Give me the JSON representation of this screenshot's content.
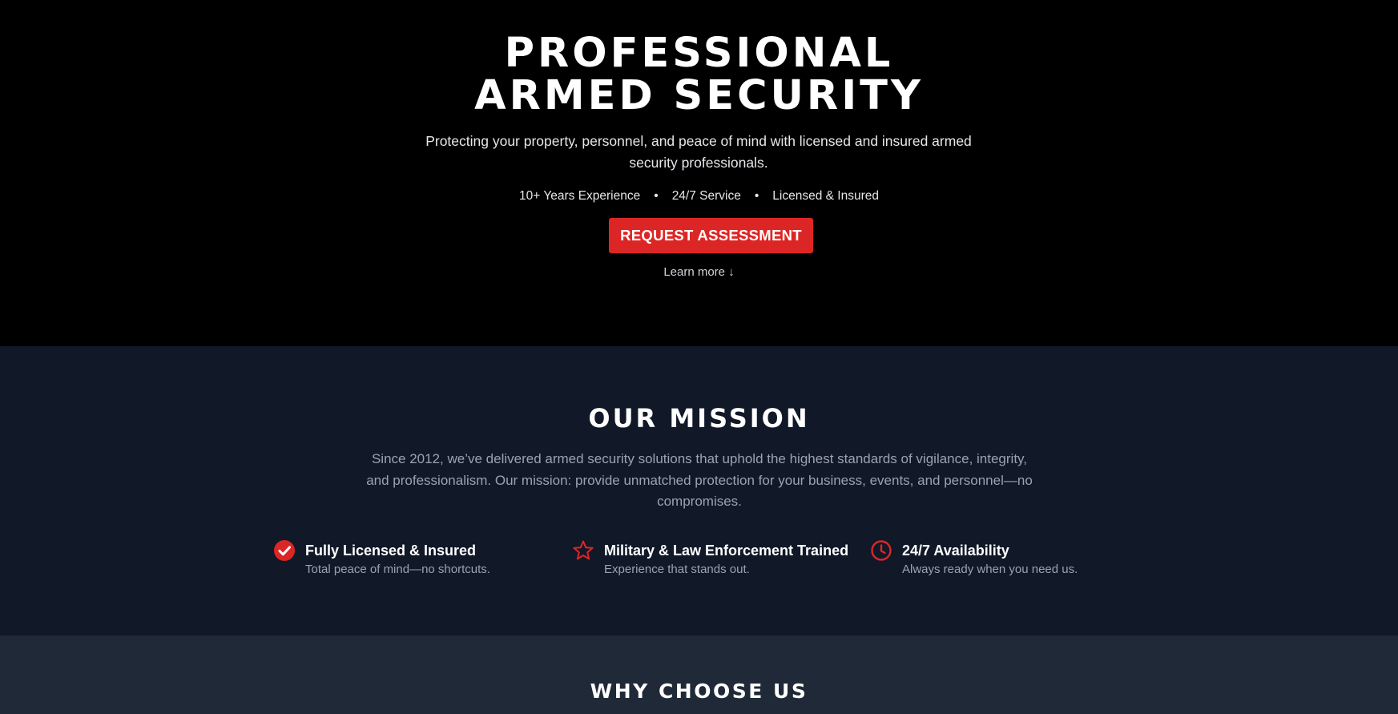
{
  "hero": {
    "title_line1": "PROFESSIONAL",
    "title_line2": "ARMED SECURITY",
    "subtitle": "Protecting your property, personnel, and peace of mind with licensed and insured armed security professionals.",
    "badges": [
      "10+ Years Experience",
      "24/7 Service",
      "Licensed & Insured"
    ],
    "badge_separator": "•",
    "cta_label": "REQUEST ASSESSMENT",
    "learn_more": "Learn more ↓"
  },
  "mission": {
    "title": "OUR MISSION",
    "text": "Since 2012, we’ve delivered armed security solutions that uphold the highest standards of vigilance, integrity, and professionalism. Our mission: provide unmatched protection for your business, events, and personnel—no compromises.",
    "features": [
      {
        "icon": "check-circle-icon",
        "title": "Fully Licensed & Insured",
        "desc": "Total peace of mind—no shortcuts."
      },
      {
        "icon": "star-icon",
        "title": "Military & Law Enforcement Trained",
        "desc": "Experience that stands out."
      },
      {
        "icon": "clock-icon",
        "title": "24/7 Availability",
        "desc": "Always ready when you need us."
      }
    ]
  },
  "why": {
    "title": "WHY CHOOSE US"
  },
  "colors": {
    "accent": "#dc2626",
    "hero_bg": "#000000",
    "mission_bg": "#111827",
    "why_bg": "#1f2937",
    "muted_text": "#9ca3af"
  }
}
